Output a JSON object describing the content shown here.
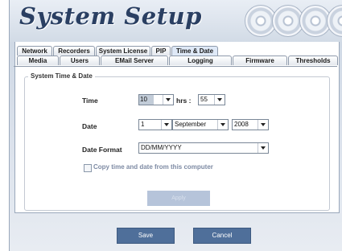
{
  "app": {
    "title": "System Setup"
  },
  "tabs": {
    "row1": [
      "Network",
      "Recorders",
      "System License",
      "PIP",
      "Time & Date"
    ],
    "row2": [
      "Media",
      "Users",
      "EMail Server",
      "Logging",
      "Firmware",
      "Thresholds"
    ],
    "active": "Time & Date"
  },
  "group": {
    "title": "System Time & Date",
    "time_label": "Time",
    "hours_value": "10",
    "hrs_label": "hrs :",
    "minutes_value": "55",
    "date_label": "Date",
    "day_value": "1",
    "month_value": "September",
    "year_value": "2008",
    "date_format_label": "Date Format",
    "date_format_value": "DD/MM/YYYY",
    "copy_checkbox_label": "Copy time and date from this computer",
    "copy_checked": false,
    "apply_label": "Apply"
  },
  "footer": {
    "save_label": "Save",
    "cancel_label": "Cancel"
  },
  "colors": {
    "title": "#2a3f62",
    "button": "#4f6f9a",
    "apply_disabled": "#b6c4da",
    "panel_bg": "#dfe5ee"
  }
}
